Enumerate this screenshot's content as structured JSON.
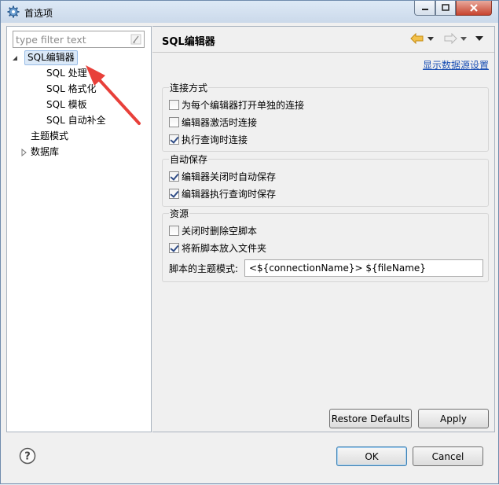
{
  "window": {
    "title": "首选项"
  },
  "filter": {
    "placeholder": "type filter text"
  },
  "tree": {
    "sql_editor": "SQL编辑器",
    "children": [
      "SQL 处理",
      "SQL 格式化",
      "SQL 模板",
      "SQL 自动补全"
    ],
    "theme": "主题模式",
    "database": "数据库"
  },
  "page": {
    "title": "SQL编辑器",
    "link": "显示数据源设置"
  },
  "groups": {
    "connection": {
      "title": "连接方式",
      "options": [
        {
          "label": "为每个编辑器打开单独的连接",
          "checked": false
        },
        {
          "label": "编辑器激活时连接",
          "checked": false
        },
        {
          "label": "执行查询时连接",
          "checked": true
        }
      ]
    },
    "autosave": {
      "title": "自动保存",
      "options": [
        {
          "label": "编辑器关闭时自动保存",
          "checked": true
        },
        {
          "label": "编辑器执行查询时保存",
          "checked": true
        }
      ]
    },
    "resources": {
      "title": "资源",
      "options": [
        {
          "label": "关闭时删除空脚本",
          "checked": false
        },
        {
          "label": "将新脚本放入文件夹",
          "checked": true
        }
      ],
      "pattern_label": "脚本的主题模式:",
      "pattern_value": "<${connectionName}> ${fileName}"
    }
  },
  "buttons": {
    "restore_defaults": "Restore Defaults",
    "apply": "Apply",
    "ok": "OK",
    "cancel": "Cancel"
  },
  "colors": {
    "link": "#1a4fb4",
    "selection": "#dbe9f8",
    "annotation_arrow": "#e8403a",
    "nav_arrow": "#e0a020"
  }
}
